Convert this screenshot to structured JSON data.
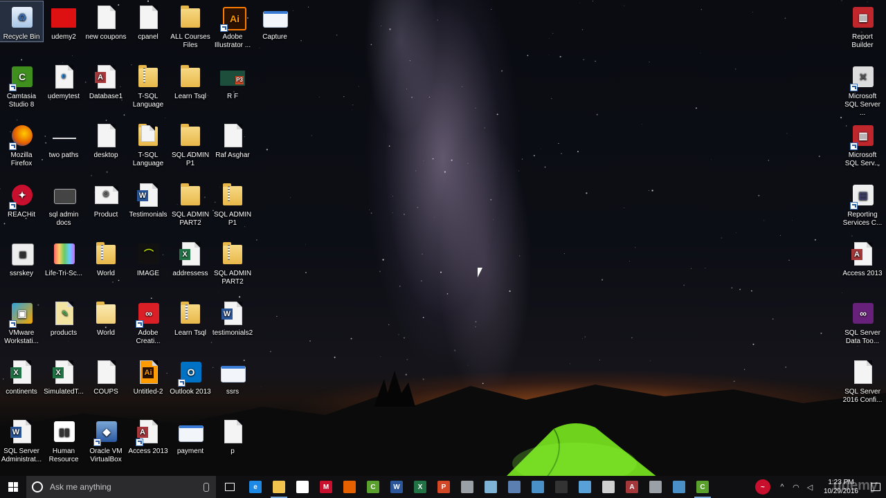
{
  "desktop": {
    "icons_left": [
      {
        "label": "Recycle Bin",
        "kind": "recycle",
        "col": 0,
        "row": 0,
        "selected": true
      },
      {
        "label": "udemy2",
        "kind": "video",
        "col": 1,
        "row": 0
      },
      {
        "label": "new coupons",
        "kind": "page",
        "col": 2,
        "row": 0
      },
      {
        "label": "cpanel",
        "kind": "page",
        "col": 3,
        "row": 0
      },
      {
        "label": "ALL Courses Files",
        "kind": "folder",
        "col": 4,
        "row": 0
      },
      {
        "label": "Adobe Illustrator ...",
        "kind": "illustrator",
        "col": 5,
        "row": 0,
        "shortcut": true
      },
      {
        "label": "Capture",
        "kind": "image",
        "col": 6,
        "row": 0
      },
      {
        "label": "Camtasia Studio 8",
        "kind": "camtasia",
        "col": 0,
        "row": 1,
        "shortcut": true
      },
      {
        "label": "udemytest",
        "kind": "ie-doc",
        "col": 1,
        "row": 1
      },
      {
        "label": "Database1",
        "kind": "access",
        "col": 2,
        "row": 1
      },
      {
        "label": "T-SQL Language",
        "kind": "zip",
        "col": 3,
        "row": 1
      },
      {
        "label": "Learn Tsql",
        "kind": "folder",
        "col": 4,
        "row": 1
      },
      {
        "label": "R F",
        "kind": "pptx-thumb",
        "col": 5,
        "row": 1
      },
      {
        "label": "Mozilla Firefox",
        "kind": "firefox",
        "col": 0,
        "row": 2,
        "shortcut": true
      },
      {
        "label": "two paths",
        "kind": "line",
        "col": 1,
        "row": 2
      },
      {
        "label": "desktop",
        "kind": "page",
        "col": 2,
        "row": 2
      },
      {
        "label": "T-SQL Language",
        "kind": "folder-doc",
        "col": 3,
        "row": 2
      },
      {
        "label": "SQL ADMIN P1",
        "kind": "folder",
        "col": 4,
        "row": 2
      },
      {
        "label": "Raf Asghar",
        "kind": "page",
        "col": 5,
        "row": 2
      },
      {
        "label": "REACHit",
        "kind": "reachit",
        "col": 0,
        "row": 3,
        "shortcut": true
      },
      {
        "label": "sql admin docs",
        "kind": "dark-window",
        "col": 1,
        "row": 3
      },
      {
        "label": "Product",
        "kind": "gear-page",
        "col": 2,
        "row": 3
      },
      {
        "label": "Testimonials",
        "kind": "word",
        "col": 3,
        "row": 3
      },
      {
        "label": "SQL ADMIN PART2",
        "kind": "folder",
        "col": 4,
        "row": 3
      },
      {
        "label": "SQL ADMIN P1",
        "kind": "zip",
        "col": 5,
        "row": 3
      },
      {
        "label": "ssrskey",
        "kind": "ssrskey",
        "col": 0,
        "row": 4
      },
      {
        "label": "Life-Tri-Sc...",
        "kind": "colorgrid",
        "col": 1,
        "row": 4
      },
      {
        "label": "World",
        "kind": "zip",
        "col": 2,
        "row": 4
      },
      {
        "label": "IMAGE",
        "kind": "imagelogo",
        "col": 3,
        "row": 4
      },
      {
        "label": "addressess",
        "kind": "excel-doc",
        "col": 4,
        "row": 4
      },
      {
        "label": "SQL ADMIN PART2",
        "kind": "zip",
        "col": 5,
        "row": 4
      },
      {
        "label": "VMware Workstati...",
        "kind": "vmware",
        "col": 0,
        "row": 5,
        "shortcut": true
      },
      {
        "label": "products",
        "kind": "products",
        "col": 1,
        "row": 5
      },
      {
        "label": "World",
        "kind": "folder-light",
        "col": 2,
        "row": 5
      },
      {
        "label": "Adobe Creati...",
        "kind": "creative",
        "col": 3,
        "row": 5,
        "shortcut": true
      },
      {
        "label": "Learn Tsql",
        "kind": "zip",
        "col": 4,
        "row": 5
      },
      {
        "label": "testimonials2",
        "kind": "word",
        "col": 5,
        "row": 5
      },
      {
        "label": "continents",
        "kind": "excel",
        "col": 0,
        "row": 6
      },
      {
        "label": "SimulatedT...",
        "kind": "excel",
        "col": 1,
        "row": 6
      },
      {
        "label": "COUPS",
        "kind": "page",
        "col": 2,
        "row": 6
      },
      {
        "label": "Untitled-2",
        "kind": "ai-doc",
        "col": 3,
        "row": 6
      },
      {
        "label": "Outlook 2013",
        "kind": "outlook",
        "col": 4,
        "row": 6,
        "shortcut": true
      },
      {
        "label": "ssrs",
        "kind": "image",
        "col": 5,
        "row": 6
      },
      {
        "label": "SQL Server Administrat...",
        "kind": "word",
        "col": 0,
        "row": 7
      },
      {
        "label": "Human Resource",
        "kind": "report",
        "col": 1,
        "row": 7
      },
      {
        "label": "Oracle VM VirtualBox",
        "kind": "vbox",
        "col": 2,
        "row": 7,
        "shortcut": true
      },
      {
        "label": "Access 2013",
        "kind": "access",
        "col": 3,
        "row": 7,
        "shortcut": true
      },
      {
        "label": "payment",
        "kind": "image",
        "col": 4,
        "row": 7
      },
      {
        "label": "p",
        "kind": "page",
        "col": 5,
        "row": 7
      }
    ],
    "icons_right": [
      {
        "label": "Report Builder",
        "kind": "reportbuilder",
        "row": 0
      },
      {
        "label": "Microsoft SQL Server ...",
        "kind": "sqltools",
        "row": 1,
        "shortcut": true
      },
      {
        "label": "Microsoft SQL Serv...",
        "kind": "reportbuilder",
        "row": 2,
        "shortcut": true
      },
      {
        "label": "Reporting Services C...",
        "kind": "rsconfig",
        "row": 3,
        "shortcut": true
      },
      {
        "label": "Access 2013",
        "kind": "access",
        "row": 4
      },
      {
        "label": "SQL Server Data Too...",
        "kind": "vs",
        "row": 5
      },
      {
        "label": "SQL Server 2016 Confi...",
        "kind": "page",
        "row": 6
      }
    ]
  },
  "taskbar": {
    "search_placeholder": "Ask me anything",
    "apps": [
      {
        "name": "edge",
        "glyph": "e",
        "color": "#1e88e5",
        "open": false
      },
      {
        "name": "file-explorer",
        "glyph": "",
        "color": "#f2c34d",
        "open": true
      },
      {
        "name": "store",
        "glyph": "",
        "color": "#ffffff",
        "open": false
      },
      {
        "name": "mcafee",
        "glyph": "M",
        "color": "#c8102e",
        "open": false
      },
      {
        "name": "firefox",
        "glyph": "",
        "color": "#e66000",
        "open": false
      },
      {
        "name": "camtasia",
        "glyph": "C",
        "color": "#5aa02c",
        "open": false
      },
      {
        "name": "word",
        "glyph": "W",
        "color": "#2b579a",
        "open": false
      },
      {
        "name": "excel",
        "glyph": "X",
        "color": "#217346",
        "open": false
      },
      {
        "name": "powerpoint",
        "glyph": "P",
        "color": "#d24726",
        "open": false
      },
      {
        "name": "sql-tool",
        "glyph": "",
        "color": "#9aa0a6",
        "open": false
      },
      {
        "name": "app-a",
        "glyph": "",
        "color": "#7fb3d5",
        "open": false
      },
      {
        "name": "app-b",
        "glyph": "",
        "color": "#5b7fb0",
        "open": false
      },
      {
        "name": "remote",
        "glyph": "",
        "color": "#4a90c8",
        "open": false
      },
      {
        "name": "terminal",
        "glyph": "",
        "color": "#333333",
        "open": false
      },
      {
        "name": "app-c",
        "glyph": "",
        "color": "#5aa0d8",
        "open": false
      },
      {
        "name": "clock-app",
        "glyph": "",
        "color": "#d0d0d0",
        "open": false
      },
      {
        "name": "access",
        "glyph": "A",
        "color": "#a4373a",
        "open": false
      },
      {
        "name": "app-d",
        "glyph": "",
        "color": "#9aa0a6",
        "open": false
      },
      {
        "name": "app-e",
        "glyph": "",
        "color": "#4a90c8",
        "open": false
      },
      {
        "name": "camtasia-recorder",
        "glyph": "C",
        "color": "#5aa02c",
        "open": true
      }
    ],
    "clock_time": "1:23 PM",
    "clock_date": "10/29/2016"
  },
  "watermark": "udemy"
}
